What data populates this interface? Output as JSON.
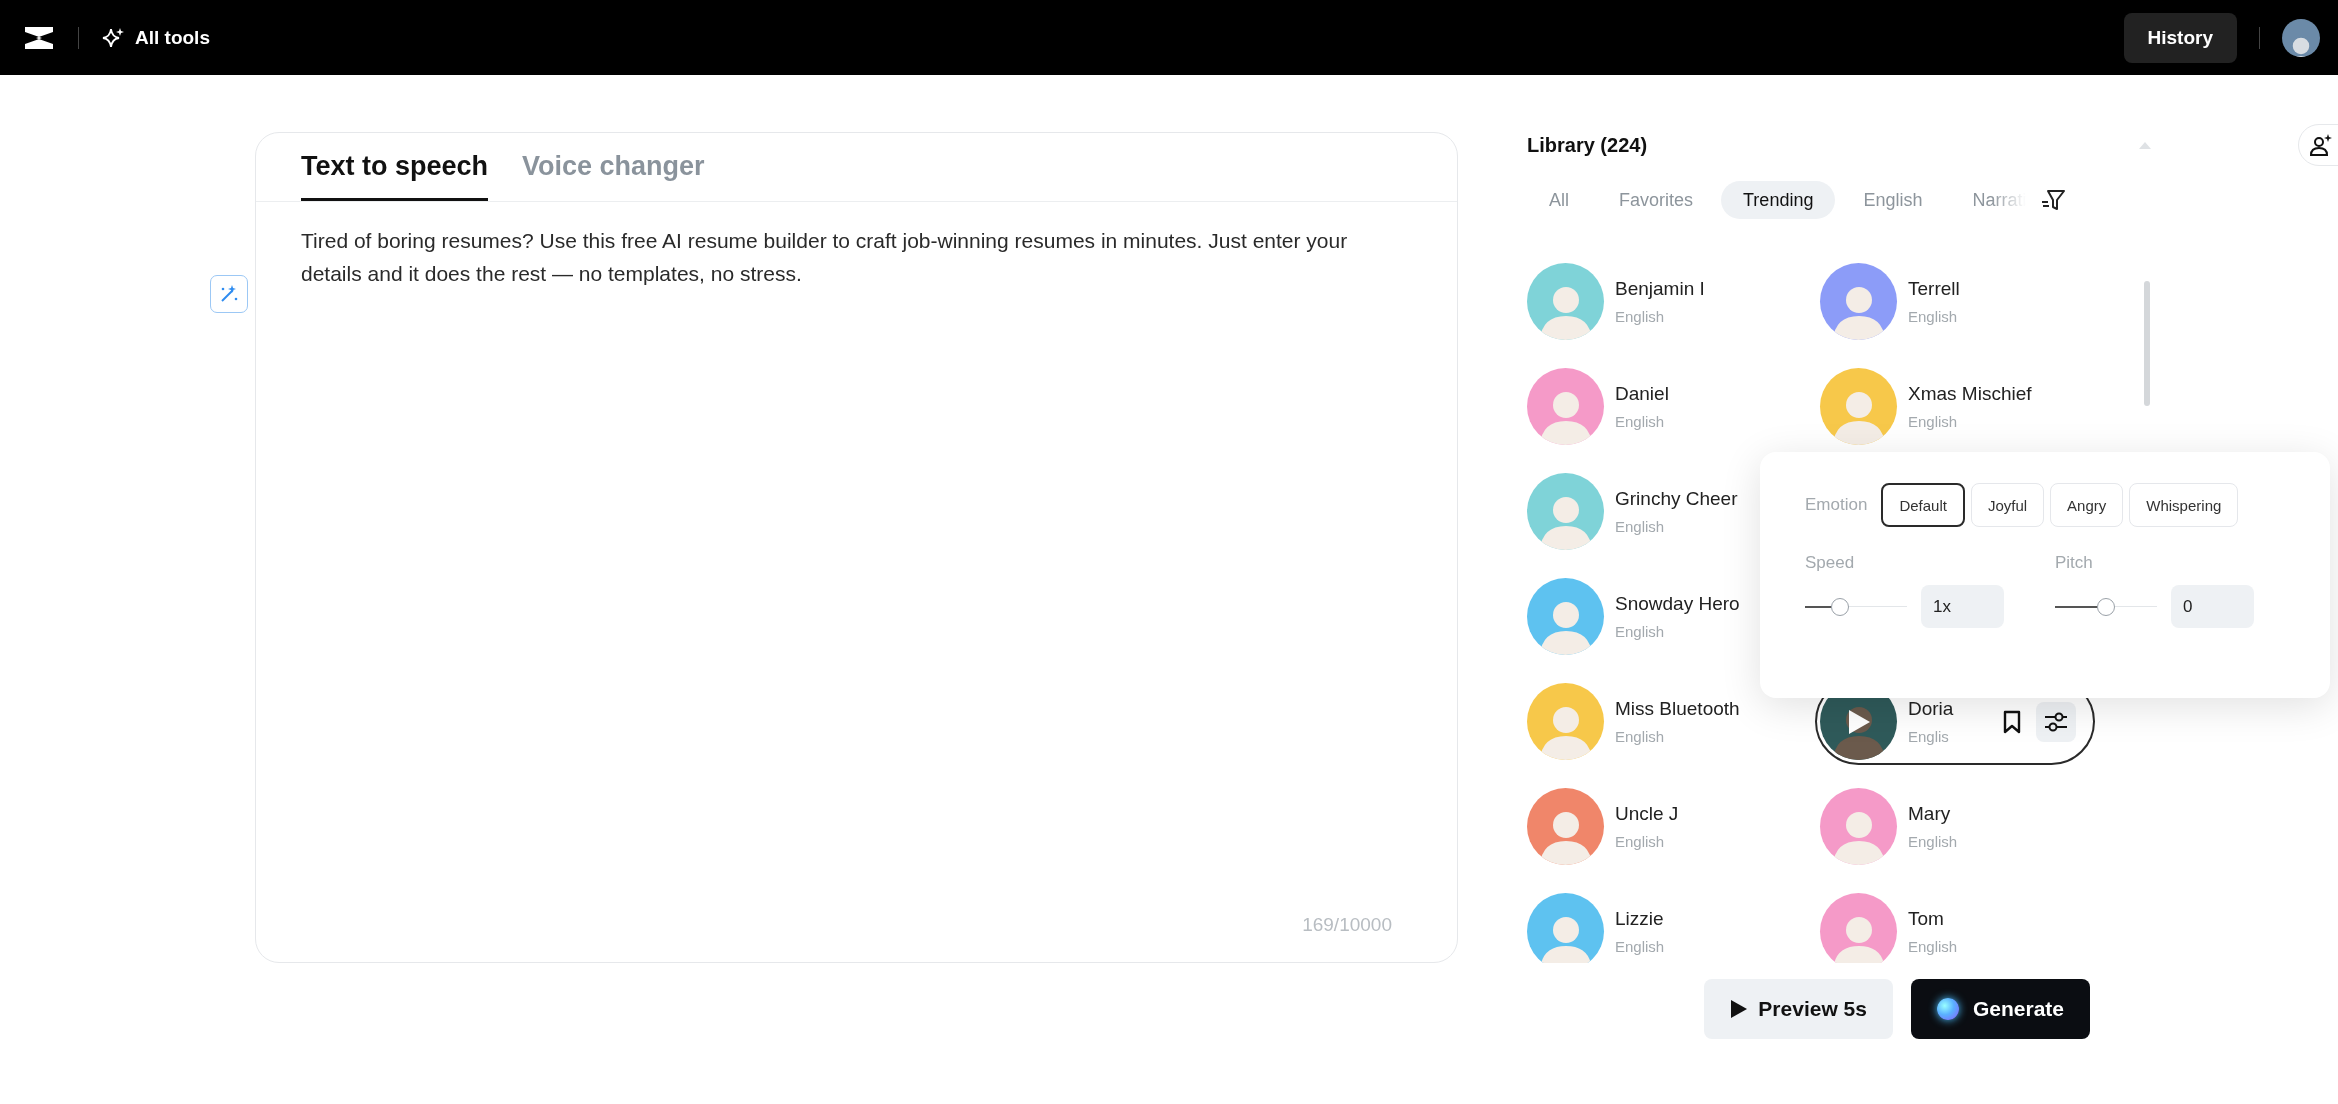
{
  "top_bar": {
    "all_tools": "All tools",
    "history": "History"
  },
  "editor": {
    "tabs": [
      {
        "label": "Text to speech",
        "selected": true
      },
      {
        "label": "Voice changer",
        "selected": false
      }
    ],
    "text": "Tired of boring resumes? Use this free AI resume builder to craft job-winning resumes in minutes. Just enter your details and it does the rest — no templates, no stress.",
    "counter": "169/10000"
  },
  "library": {
    "title": "Library (224)",
    "filters": [
      {
        "label": "All",
        "selected": false
      },
      {
        "label": "Favorites",
        "selected": false
      },
      {
        "label": "Trending",
        "selected": true
      },
      {
        "label": "English",
        "selected": false
      },
      {
        "label": "Narrati",
        "selected": false
      }
    ],
    "voice_rows": [
      {
        "cells": [
          {
            "name": "Benjamin I",
            "language": "English",
            "color": "#7fd3d8",
            "selected": false
          },
          {
            "name": "Terrell",
            "language": "English",
            "color": "#8c9cf8",
            "selected": false
          }
        ]
      },
      {
        "cells": [
          {
            "name": "Daniel",
            "language": "English",
            "color": "#f59ac8",
            "selected": false
          },
          {
            "name": "Xmas Mischief",
            "language": "English",
            "color": "#f7c84a",
            "selected": false
          }
        ]
      },
      {
        "cells": [
          {
            "name": "Grinchy Cheer",
            "language": "English",
            "color": "#7fd3d8",
            "selected": false
          }
        ]
      },
      {
        "cells": [
          {
            "name": "Snowday Hero",
            "language": "English",
            "color": "#5ec2f0",
            "selected": false
          }
        ]
      },
      {
        "cells": [
          {
            "name": "Miss Bluetooth",
            "language": "English",
            "color": "#f7c84a",
            "selected": false
          },
          {
            "name": "Doria",
            "language": "Englis",
            "color": "#2f5a5a",
            "selected": true
          }
        ]
      },
      {
        "cells": [
          {
            "name": "Uncle J",
            "language": "English",
            "color": "#f0866a",
            "selected": false
          },
          {
            "name": "Mary",
            "language": "English",
            "color": "#f59ac8",
            "selected": false
          }
        ]
      },
      {
        "cells": [
          {
            "name": "Lizzie",
            "language": "English",
            "color": "#5ec2f0",
            "selected": false
          },
          {
            "name": "Tom",
            "language": "English",
            "color": "#f59ac8",
            "selected": false
          }
        ]
      }
    ],
    "voice_settings": {
      "emotion_label": "Emotion",
      "emotions": [
        {
          "label": "Default",
          "selected": true
        },
        {
          "label": "Joyful",
          "selected": false
        },
        {
          "label": "Angry",
          "selected": false
        },
        {
          "label": "Whispering",
          "selected": false
        }
      ],
      "speed": {
        "label": "Speed",
        "level": 0.34,
        "value": "1x"
      },
      "pitch": {
        "label": "Pitch",
        "level": 0.5,
        "value": "0"
      }
    }
  },
  "actions": {
    "preview": "Preview 5s",
    "generate": "Generate"
  }
}
